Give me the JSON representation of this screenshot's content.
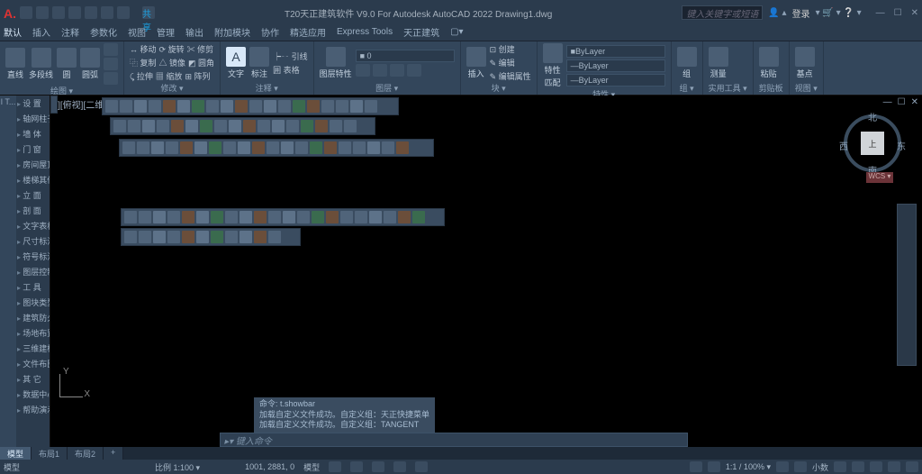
{
  "title": "T20天正建筑软件 V9.0 For Autodesk AutoCAD 2022   Drawing1.dwg",
  "share": "共享",
  "search_placeholder": "键入关键字或短语",
  "login": "登录",
  "menu": [
    "默认",
    "插入",
    "注释",
    "参数化",
    "视图",
    "管理",
    "输出",
    "附加模块",
    "协作",
    "精选应用",
    "Express Tools",
    "天正建筑",
    "▢▾"
  ],
  "ribbon": {
    "p1": {
      "btns": [
        "直线",
        "多段线",
        "圆",
        "圆弧"
      ],
      "label": "绘图 ▾"
    },
    "p2": {
      "rows": [
        [
          "↔ 移动",
          "⟳ 旋转",
          "✂ 修剪"
        ],
        [
          "⿻ 复制",
          "△ 镜像",
          "◩ 圆角"
        ],
        [
          "⤹ 拉伸",
          "▦ 缩放",
          "⊞ 阵列"
        ]
      ],
      "label": "修改 ▾"
    },
    "p3": {
      "btns": [
        "文字",
        "标注"
      ],
      "rows": [
        [
          "┝╌ 引线"
        ],
        [
          "囲 表格"
        ]
      ],
      "label": "注释 ▾"
    },
    "p4": {
      "rows": [
        [
          "图层特性"
        ]
      ],
      "label": "图层 ▾"
    },
    "p5": {
      "btns": [
        "插入"
      ],
      "rows": [
        [
          "⊡ 创建"
        ],
        [
          "✎ 编辑"
        ],
        [
          "✎ 编辑属性"
        ]
      ],
      "label": "块 ▾"
    },
    "p6": {
      "btns": [
        "特性",
        "匹配"
      ],
      "dd": [
        "ByLayer",
        "ByLayer",
        "ByLayer"
      ],
      "label": "特性 ▾"
    },
    "p7": {
      "btns": [
        "组"
      ],
      "label": "组 ▾"
    },
    "p8": {
      "btns": [
        "测量"
      ],
      "label": "实用工具 ▾"
    },
    "p9": {
      "btns": [
        "粘贴"
      ],
      "label": "剪贴板"
    },
    "p10": {
      "btns": [
        "基点"
      ],
      "label": "视图 ▾"
    }
  },
  "leftbar": "I T...",
  "palette": [
    "设  置",
    "轴网柱子",
    "墙  体",
    "门  窗",
    "房间屋顶",
    "楼梯其他",
    "立  面",
    "剖  面",
    "文字表格",
    "尺寸标注",
    "符号标注",
    "图层控制",
    "工  具",
    "图块类型",
    "建筑防火",
    "场地布置",
    "三维建模",
    "文件布图",
    "其  它",
    "数据中心",
    "帮助演示"
  ],
  "viewport_label": "[-][俯视][二维线框]",
  "viewcube": {
    "top": "上",
    "n": "北",
    "s": "南",
    "e": "东",
    "w": "西",
    "home": "WCS ▾"
  },
  "ucs": {
    "x": "X",
    "y": "Y"
  },
  "cmd_history": [
    "命令: t.showbar",
    "加载自定义文件成功。自定义组：天正快捷菜单",
    "加载自定义文件成功。自定义组：TANGENT"
  ],
  "cmd_prompt": "▸▾ 键入命令",
  "layouts": {
    "active": "模型",
    "tabs": [
      "布局1",
      "布局2",
      "+"
    ]
  },
  "status_left": {
    "model": "模型",
    "scale": "比例 1:100 ▾",
    "coords": "1001, 2881, 0",
    "space": "模型"
  },
  "status_right": {
    "ratio": "1:1 / 100% ▾",
    "dec": "小数",
    "ws": "▾"
  }
}
